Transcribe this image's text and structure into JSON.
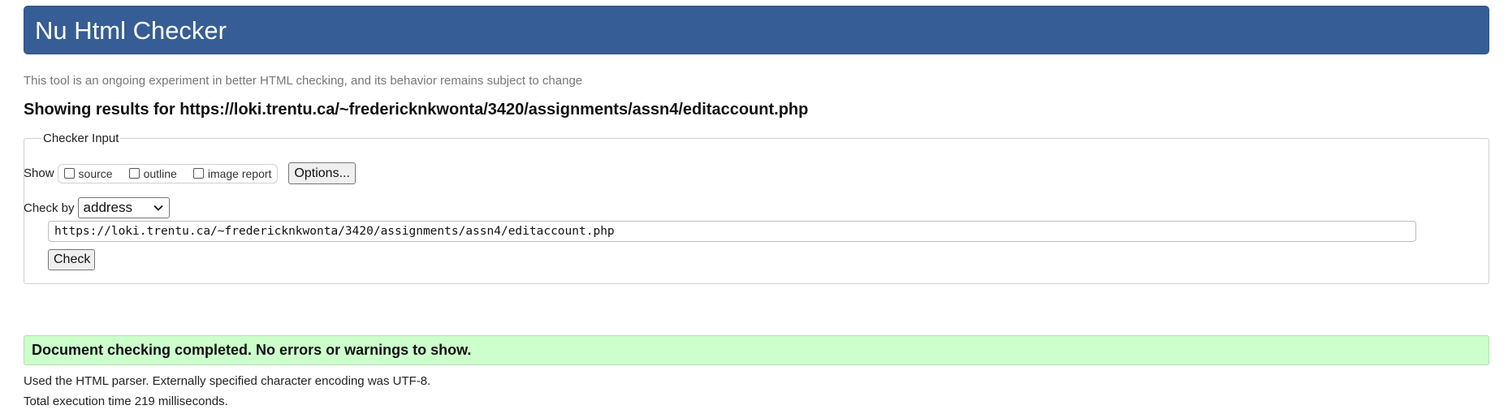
{
  "header": {
    "title": "Nu Html Checker"
  },
  "subtitle": "This tool is an ongoing experiment in better HTML checking, and its behavior remains subject to change",
  "results_heading": "Showing results for https://loki.trentu.ca/~fredericknkwonta/3420/assignments/assn4/editaccount.php",
  "checker_input": {
    "legend": "Checker Input",
    "show_label": "Show",
    "show_options": [
      {
        "label": "source",
        "checked": false
      },
      {
        "label": "outline",
        "checked": false
      },
      {
        "label": "image report",
        "checked": false
      }
    ],
    "options_button": "Options...",
    "check_by_label": "Check by",
    "check_by_selected": "address",
    "url_value": "https://loki.trentu.ca/~fredericknkwonta/3420/assignments/assn4/editaccount.php",
    "check_button": "Check"
  },
  "result": {
    "message": "Document checking completed. No errors or warnings to show.",
    "parser_info": "Used the HTML parser. Externally specified character encoding was UTF-8.",
    "execution_time": "Total execution time 219 milliseconds."
  },
  "colors": {
    "header_bg": "#365d95",
    "success_bg": "#ccffcc"
  },
  "icons": {
    "select_arrow": "chevron-down-icon",
    "checkbox": "checkbox-icon"
  }
}
